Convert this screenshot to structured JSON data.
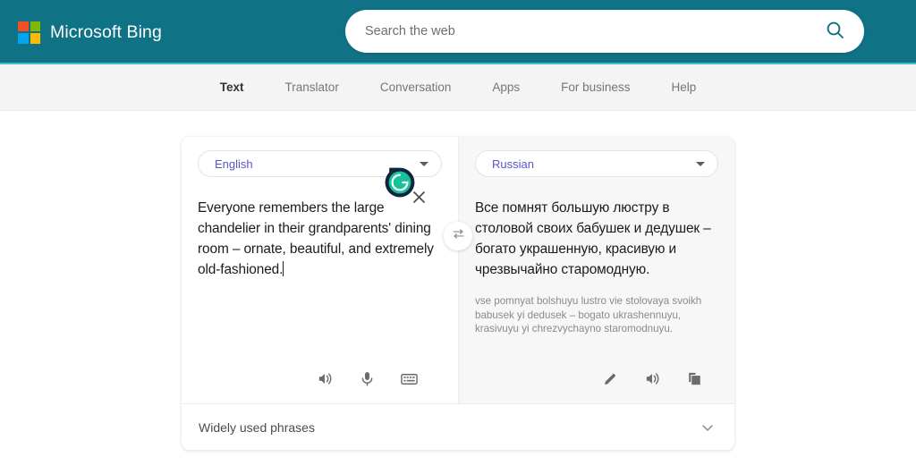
{
  "header": {
    "brand_name": "Microsoft Bing",
    "brand_color": "#0f7285",
    "accent_color": "#46bcc9",
    "logo_colors": [
      "#f25022",
      "#7fba00",
      "#00a4ef",
      "#ffb900"
    ],
    "logo_icon": "microsoft-logo-icon"
  },
  "search": {
    "placeholder": "Search the web",
    "value": "",
    "icon": "search-icon"
  },
  "nav": {
    "items": [
      {
        "label": "Text",
        "active": true
      },
      {
        "label": "Translator",
        "active": false
      },
      {
        "label": "Conversation",
        "active": false
      },
      {
        "label": "Apps",
        "active": false
      },
      {
        "label": "For business",
        "active": false
      },
      {
        "label": "Help",
        "active": false
      }
    ]
  },
  "translator": {
    "source": {
      "language": "English",
      "language_color": "#5a56c8",
      "text": "Everyone remembers the large chandelier in their grandparents' dining room – ornate, beautiful, and extremely old-fashioned.",
      "has_cursor": true,
      "tools": [
        {
          "name": "listen-source-button",
          "icon": "speaker-icon"
        },
        {
          "name": "microphone-button",
          "icon": "microphone-icon"
        },
        {
          "name": "keyboard-button",
          "icon": "keyboard-icon"
        }
      ]
    },
    "target": {
      "language": "Russian",
      "language_color": "#5a56c8",
      "text": "Все помнят большую люстру в столовой своих бабушек и дедушек – богато украшенную, красивую и чрезвычайно старомодную.",
      "transliteration": "vse pomnyat bolshuyu lustro vie stolovaya svoikh babusek yi dedusek – bogato ukrashennuyu, krasivuyu yi chrezvychayno staromodnuyu.",
      "tools": [
        {
          "name": "edit-translation-button",
          "icon": "pencil-icon"
        },
        {
          "name": "listen-translation-button",
          "icon": "speaker-icon"
        },
        {
          "name": "copy-translation-button",
          "icon": "copy-icon"
        }
      ]
    },
    "swap_button": {
      "name": "swap-languages-button",
      "icon": "swap-arrows-icon"
    },
    "clear_button": {
      "name": "clear-text-button",
      "icon": "close-icon"
    },
    "grammarly": {
      "name": "grammarly-badge",
      "icon": "grammarly-icon",
      "letter": "G",
      "circle_color": "#15c39a",
      "pin_color": "#11243e"
    },
    "phrases": {
      "label": "Widely used phrases",
      "icon": "chevron-down-icon"
    }
  }
}
